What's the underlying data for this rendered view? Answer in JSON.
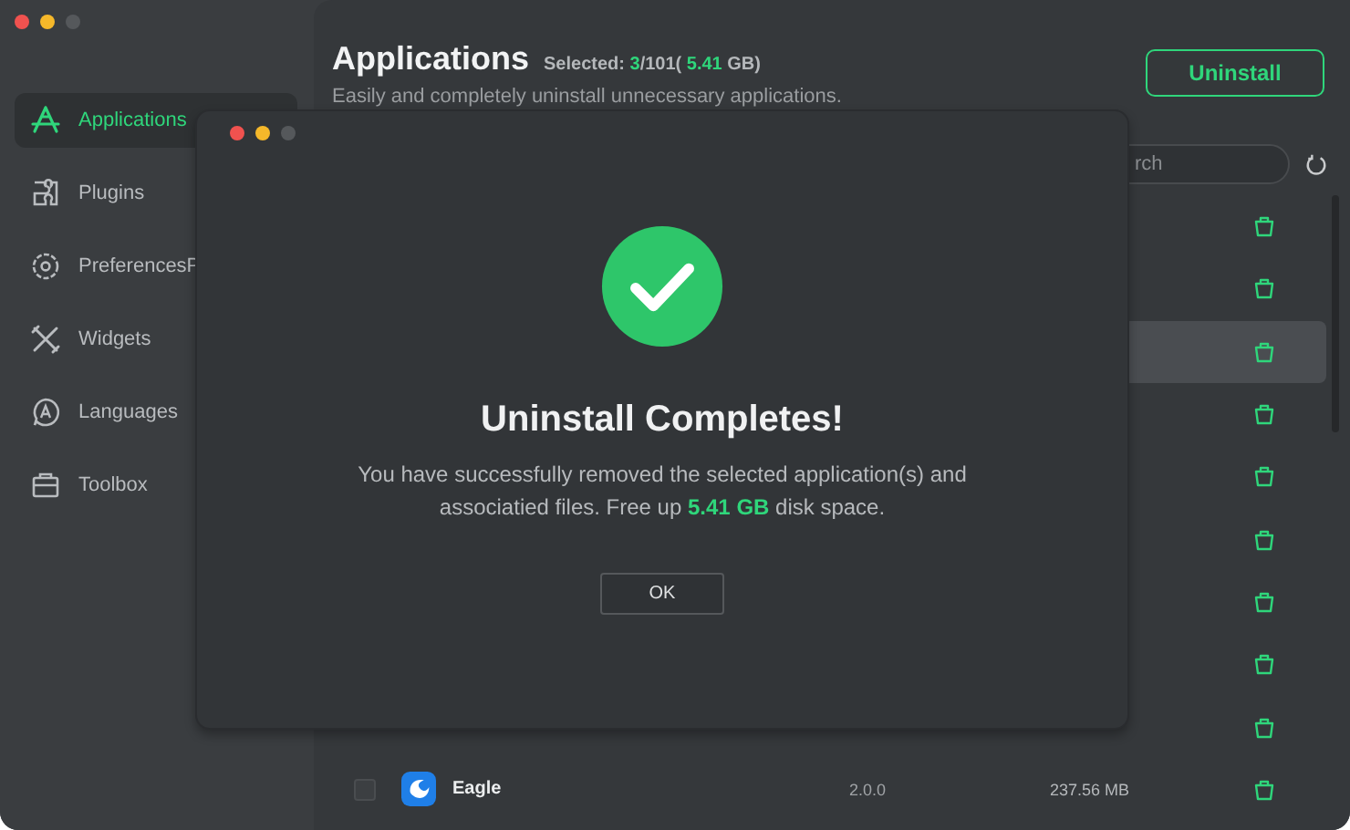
{
  "sidebar": {
    "items": [
      {
        "label": "Applications",
        "selected": true
      },
      {
        "label": "Plugins",
        "selected": false
      },
      {
        "label": "PreferencesP",
        "selected": false
      },
      {
        "label": "Widgets",
        "selected": false
      },
      {
        "label": "Languages",
        "selected": false
      },
      {
        "label": "Toolbox",
        "selected": false
      }
    ]
  },
  "header": {
    "title": "Applications",
    "selected_label": "Selected:",
    "selected_count": "3",
    "total": "/101(",
    "selected_size": "5.41",
    "size_unit": "GB)",
    "subtitle": "Easily and completely uninstall unnecessary applications.",
    "uninstall_button": "Uninstall"
  },
  "search": {
    "placeholder": "rch"
  },
  "rows": [
    {
      "highlighted": false
    },
    {
      "highlighted": false
    },
    {
      "highlighted": true
    },
    {
      "highlighted": false
    },
    {
      "highlighted": false
    },
    {
      "highlighted": false
    },
    {
      "highlighted": false
    },
    {
      "highlighted": false
    },
    {
      "highlighted": false
    },
    {
      "highlighted": false,
      "checked": false,
      "name": "Eagle",
      "version": "2.0.0",
      "size": "237.56 MB"
    }
  ],
  "dialog": {
    "title": "Uninstall Completes!",
    "message_before": "You have successfully removed the selected application(s) and associatied files. Free up",
    "freed": "5.41 GB",
    "message_after": "disk space.",
    "ok_button": "OK"
  }
}
